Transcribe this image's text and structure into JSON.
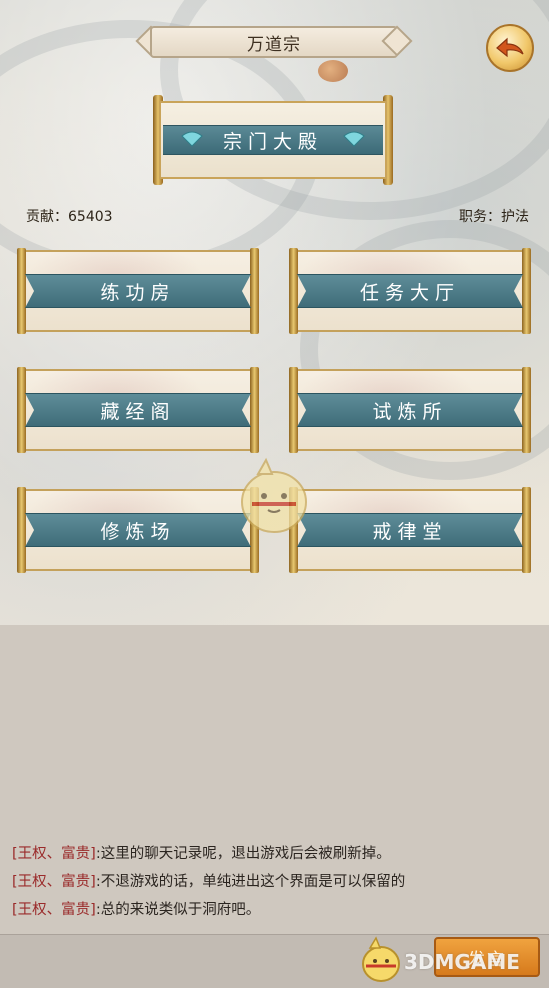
{
  "header": {
    "title": "万道宗",
    "back_icon": "back-arrow-icon"
  },
  "hall": {
    "label": "宗门大殿"
  },
  "info": {
    "contribution": "贡献：65403",
    "position": "职务：护法"
  },
  "buildings": [
    {
      "label": "练功房"
    },
    {
      "label": "任务大厅"
    },
    {
      "label": "藏经阁"
    },
    {
      "label": "试炼所"
    },
    {
      "label": "修炼场"
    },
    {
      "label": "戒律堂"
    }
  ],
  "chat": {
    "messages": [
      {
        "sender": "[王权、富贵]",
        "text": ":这里的聊天记录呢，退出游戏后会被刷新掉。"
      },
      {
        "sender": "[王权、富贵]",
        "text": ":不退游戏的话，单纯进出这个界面是可以保留的"
      },
      {
        "sender": "[王权、富贵]",
        "text": ":总的来说类似于洞府吧。"
      }
    ]
  },
  "footer": {
    "speak_label": "发言",
    "watermark": "3DMGAME"
  },
  "colors": {
    "banner_teal": "#4a7784",
    "gold": "#c9a45a",
    "speak_orange": "#e38d2c"
  }
}
